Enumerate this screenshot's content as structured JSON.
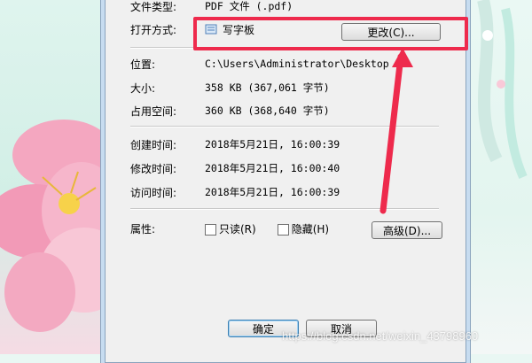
{
  "dialog": {
    "file_type": {
      "label": "文件类型:",
      "value": "PDF 文件 (.pdf)"
    },
    "open_with": {
      "label": "打开方式:",
      "app_name": "写字板",
      "change_button": "更改(C)..."
    },
    "location": {
      "label": "位置:",
      "value": "C:\\Users\\Administrator\\Desktop"
    },
    "size": {
      "label": "大小:",
      "value": "358 KB (367,061 字节)"
    },
    "size_on_disk": {
      "label": "占用空间:",
      "value": "360 KB (368,640 字节)"
    },
    "created": {
      "label": "创建时间:",
      "value": "2018年5月21日, 16:00:39"
    },
    "modified": {
      "label": "修改时间:",
      "value": "2018年5月21日, 16:00:40"
    },
    "accessed": {
      "label": "访问时间:",
      "value": "2018年5月21日, 16:00:39"
    },
    "attributes": {
      "label": "属性:",
      "readonly": "只读(R)",
      "hidden": "隐藏(H)",
      "advanced_button": "高级(D)..."
    },
    "ok_button": "确定",
    "cancel_button": "取消"
  },
  "watermark": "https://blog.csdn.net/weixin_43798960",
  "colors": {
    "highlight": "#ee2a4c",
    "dialog_bg": "#f0f0f0"
  }
}
